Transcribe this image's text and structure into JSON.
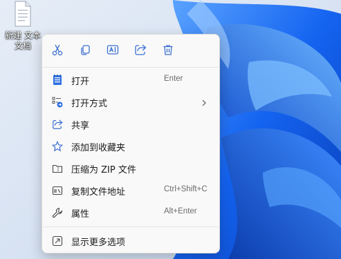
{
  "desktop": {
    "file_label": "新建 文本文档"
  },
  "quick_actions": [
    {
      "name": "cut",
      "icon": "scissors-icon"
    },
    {
      "name": "copy",
      "icon": "copy-icon"
    },
    {
      "name": "rename",
      "icon": "rename-icon"
    },
    {
      "name": "share",
      "icon": "share-icon"
    },
    {
      "name": "delete",
      "icon": "trash-icon"
    }
  ],
  "menu": {
    "items": [
      {
        "label": "打开",
        "shortcut": "Enter",
        "icon": "notepad-icon"
      },
      {
        "label": "打开方式",
        "shortcut": "",
        "icon": "open-with-icon",
        "submenu": true
      },
      {
        "label": "共享",
        "shortcut": "",
        "icon": "share-icon"
      },
      {
        "label": "添加到收藏夹",
        "shortcut": "",
        "icon": "star-icon"
      },
      {
        "label": "压缩为 ZIP 文件",
        "shortcut": "",
        "icon": "zip-folder-icon"
      },
      {
        "label": "复制文件地址",
        "shortcut": "Ctrl+Shift+C",
        "icon": "copy-path-icon"
      },
      {
        "label": "属性",
        "shortcut": "Alt+Enter",
        "icon": "wrench-icon"
      },
      {
        "label": "显示更多选项",
        "shortcut": "",
        "icon": "more-options-icon"
      }
    ]
  },
  "colors": {
    "accent": "#2b7de9",
    "menu_bg": "#f9f9f9",
    "wallpaper_blue": "#1a5fe0"
  }
}
